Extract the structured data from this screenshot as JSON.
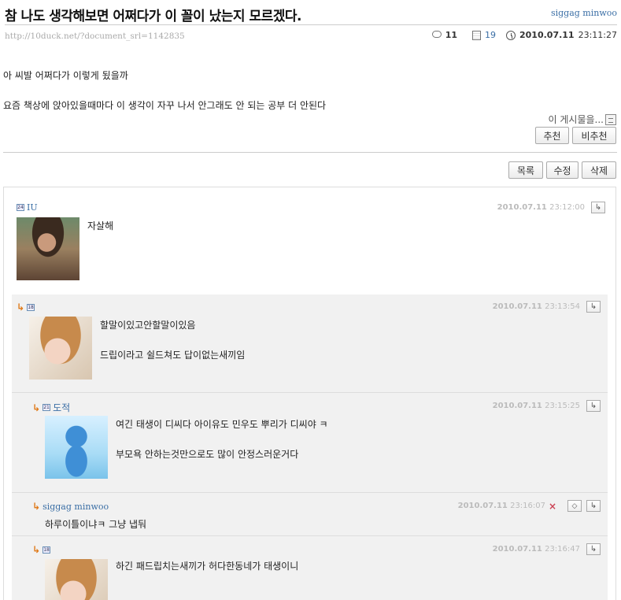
{
  "post": {
    "title": "참 나도 생각해보면 어쩌다가 이 꼴이 났는지 모르겠다.",
    "author": "siggag minwoo",
    "url": "http://10duck.net/?document_srl=1142835",
    "comment_count": "11",
    "view_count": "19",
    "date": "2010.07.11",
    "time": "23:11:27",
    "body": [
      "아 씨발 어쩌다가 이렇게 됬을까",
      "요즘 책상에 앉아있을때마다 이 생각이 자꾸 나서 안그래도 안 되는 공부 더 안된다"
    ],
    "this_post_label": "이 게시물을..."
  },
  "buttons": {
    "recommend": "추천",
    "unrecommend": "비추천",
    "list": "목록",
    "edit": "수정",
    "delete": "삭제"
  },
  "comments": [
    {
      "level_icon": "24",
      "nick": "IU",
      "date": "2010.07.11",
      "time": "23:12:00",
      "lines": [
        "자살해"
      ]
    },
    {
      "level_icon": "18",
      "nick": "",
      "date": "2010.07.11",
      "time": "23:13:54",
      "lines": [
        "할말이있고안할말이있음",
        "드립이라고 쉴드쳐도 답이없는새끼임"
      ]
    },
    {
      "level_icon": "21",
      "nick": "도적",
      "date": "2010.07.11",
      "time": "23:15:25",
      "lines": [
        "여긴 태생이 디씨다 아이유도 민우도 뿌리가 디씨야 ㅋ",
        "부모욕 안하는것만으로도 많이 안정스러운거다"
      ]
    },
    {
      "level_icon": "",
      "nick": "siggag minwoo",
      "date": "2010.07.11",
      "time": "23:16:07",
      "lines": [
        "하루이틀이냐ㅋ 그냥 냅둬"
      ]
    },
    {
      "level_icon": "18",
      "nick": "",
      "date": "2010.07.11",
      "time": "23:16:47",
      "lines": [
        "하긴 패드립치는새끼가 허다한동네가 태생이니"
      ]
    }
  ],
  "icons": {
    "reply": "reply-arrow-icon",
    "comment": "comment-bubble-icon",
    "views": "document-icon",
    "clock": "clock-icon",
    "delete": "x-icon",
    "edit": "eraser-icon",
    "menu": "menu-icon"
  },
  "colors": {
    "link": "#3a6ea5",
    "reply_arrow": "#e07a1a",
    "reply_bg": "#f1f1f1"
  }
}
